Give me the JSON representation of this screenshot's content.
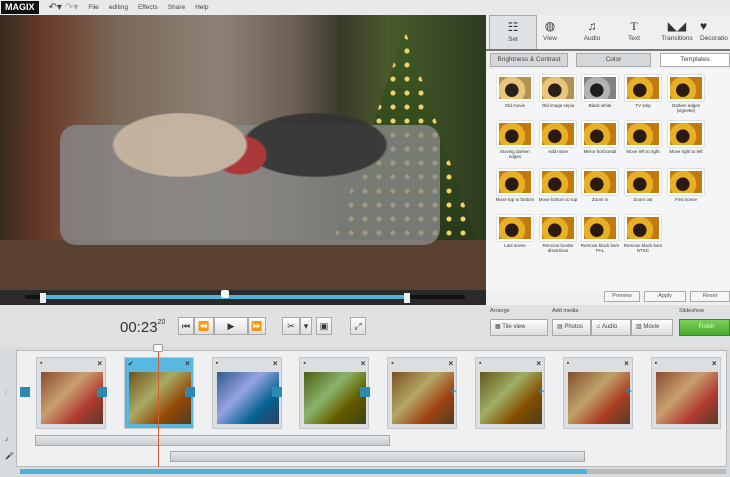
{
  "app": {
    "logo": "MAGIX"
  },
  "menu": [
    "File",
    "editing",
    "Effects",
    "Share",
    "Help"
  ],
  "right_panel": {
    "tabs": [
      {
        "label": "Set",
        "icon": "sliders-icon"
      },
      {
        "label": "View",
        "icon": "view-icon"
      },
      {
        "label": "Audio",
        "icon": "music-note-icon"
      },
      {
        "label": "Text",
        "icon": "text-icon"
      },
      {
        "label": "Transitions",
        "icon": "transitions-icon"
      },
      {
        "label": "Decoratio",
        "icon": "decoration-icon"
      }
    ],
    "active_tab": "Set",
    "subtabs": [
      "Brightness & Contrast",
      "Color",
      "Templates"
    ],
    "active_subtab": "Templates",
    "templates": [
      "Old movie",
      "Old image sepia",
      "Black white",
      "TV strip",
      "Darken edges (vignette)",
      "Moving darken edges",
      "Add noise",
      "Mirror horizontal",
      "Move left to right",
      "Move right to left",
      "Move top to bottom",
      "Move bottom to top",
      "Zoom in",
      "Zoom out",
      "First scene",
      "Last scene",
      "Remove border distortions",
      "Remove black bars PAL",
      "Remove black bars NTSC"
    ],
    "buttons": [
      "Preview",
      "Apply",
      "Reset"
    ]
  },
  "transport": {
    "time_main": "00:23",
    "time_frames": "20",
    "scrub_progress": 0.5
  },
  "toolbar": {
    "arrange_label": "Arrange",
    "tile_view": "Tile view",
    "add_media_label": "Add media",
    "photos": "Photos",
    "audio": "Audio",
    "movie": "Movie",
    "slideshow_label": "Slideshow",
    "finish": "Finish",
    "finish_color": "#5cbc3c"
  },
  "storyboard": {
    "clip_count": 8,
    "selected_clip": 2,
    "transitions": [
      "cross",
      "cross",
      "cross",
      "cross",
      "plus",
      "plus",
      "plus"
    ],
    "scroll_progress": 0.8
  },
  "colors": {
    "accent": "#4fb2d8",
    "transition": "#2a8ab0"
  }
}
